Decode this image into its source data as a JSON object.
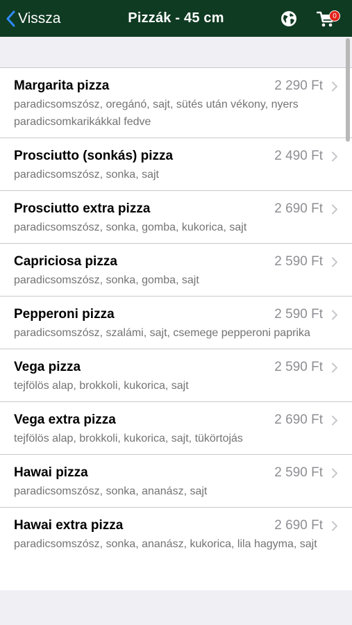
{
  "navbar": {
    "back_label": "Vissza",
    "title": "Pizzák - 45 cm",
    "globe_icon": "globe-icon",
    "cart_icon": "cart-icon",
    "cart_count": "0",
    "background_color": "#0f3b22"
  },
  "pizzas": [
    {
      "name": "Margarita pizza",
      "price": "2 290 Ft",
      "description": "paradicsomszósz, oregánó, sajt, sütés után vékony, nyers paradicsomkarikákkal fedve"
    },
    {
      "name": "Prosciutto (sonkás) pizza",
      "price": "2 490 Ft",
      "description": "paradicsomszósz, sonka, sajt"
    },
    {
      "name": "Prosciutto extra pizza",
      "price": "2 690 Ft",
      "description": "paradicsomszósz, sonka, gomba, kukorica, sajt"
    },
    {
      "name": "Capriciosa pizza",
      "price": "2 590 Ft",
      "description": "paradicsomszósz, sonka, gomba, sajt"
    },
    {
      "name": "Pepperoni pizza",
      "price": "2 590 Ft",
      "description": "paradicsomszósz, szalámi, sajt, csemege pepperoni paprika"
    },
    {
      "name": "Vega pizza",
      "price": "2 590 Ft",
      "description": "tejfölös alap, brokkoli, kukorica, sajt"
    },
    {
      "name": "Vega extra pizza",
      "price": "2 690 Ft",
      "description": "tejfölös alap, brokkoli, kukorica, sajt, tükörtojás"
    },
    {
      "name": "Hawai pizza",
      "price": "2 590 Ft",
      "description": "paradicsomszósz, sonka, ananász, sajt"
    },
    {
      "name": "Hawai extra pizza",
      "price": "2 690 Ft",
      "description": "paradicsomszósz, sonka, ananász, kukorica, lila hagyma, sajt"
    }
  ]
}
